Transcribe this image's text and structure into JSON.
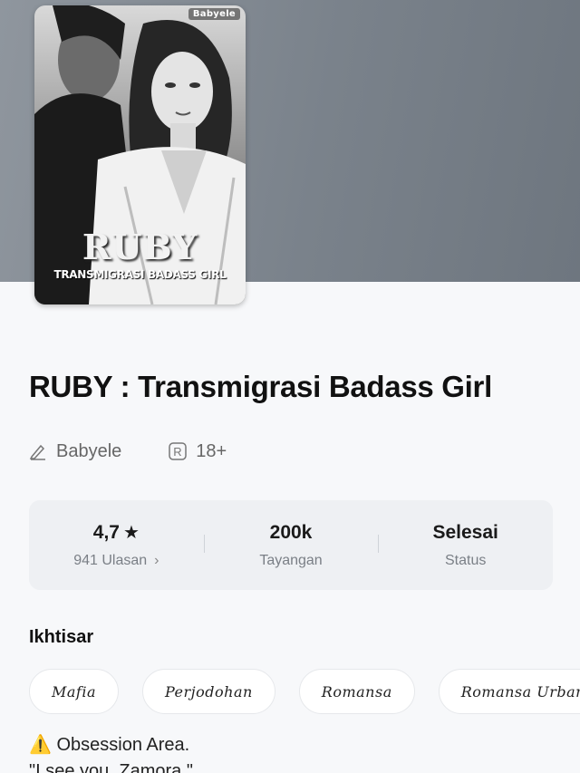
{
  "cover": {
    "author_watermark": "Babyele",
    "title_art": "RUBY",
    "subtitle_art": "TRANSMIGRASI BADASS GIRL"
  },
  "book": {
    "title": "RUBY : Transmigrasi Badass Girl",
    "author": "Babyele",
    "rating_age": "18+"
  },
  "stats": {
    "rating_value": "4,7",
    "reviews_label": "941 Ulasan",
    "views_value": "200k",
    "views_label": "Tayangan",
    "status_value": "Selesai",
    "status_label": "Status"
  },
  "overview": {
    "title": "Ikhtisar",
    "tags": [
      "Mafia",
      "Perjodohan",
      "Romansa",
      "Romansa Urban"
    ],
    "synopsis_line1": "⚠️ Obsession Area.",
    "synopsis_line2": "\"I see you, Zamora.\""
  },
  "colors": {
    "hero_bg": "#7a828b",
    "card_bg": "#eef0f3",
    "page_bg": "#f7f8fa"
  },
  "icons": [
    "pen-icon",
    "r-rating-icon",
    "star-icon",
    "chevron-right-icon",
    "warning-icon"
  ]
}
